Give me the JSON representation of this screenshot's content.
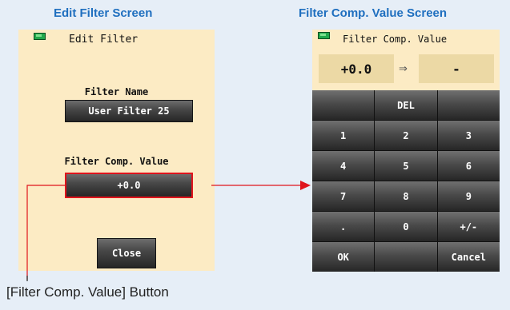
{
  "captions": {
    "left": "Edit Filter Screen",
    "right": "Filter Comp. Value Screen"
  },
  "edit_filter": {
    "title": "Edit Filter",
    "filter_name_label": "Filter Name",
    "filter_name_value": "User Filter 25",
    "comp_label": "Filter Comp. Value",
    "comp_value": "+0.0",
    "close_label": "Close"
  },
  "comp_screen": {
    "title": "Filter Comp. Value",
    "current_value": "+0.0",
    "arrow": "⇒",
    "new_value": "-",
    "keys": [
      "",
      "DEL",
      "",
      "1",
      "2",
      "3",
      "4",
      "5",
      "6",
      "7",
      "8",
      "9",
      ".",
      "0",
      "+/-",
      "OK",
      "",
      "Cancel"
    ]
  },
  "annotation": {
    "text": "[Filter Comp. Value] Button"
  },
  "colors": {
    "background": "#e6eef7",
    "screen": "#fcebc4",
    "caption": "#1f6fbf",
    "highlight": "#e0141c",
    "battery": "#22a84b"
  },
  "icons": {
    "battery": "battery-icon",
    "arrow": "arrow-right-icon"
  }
}
